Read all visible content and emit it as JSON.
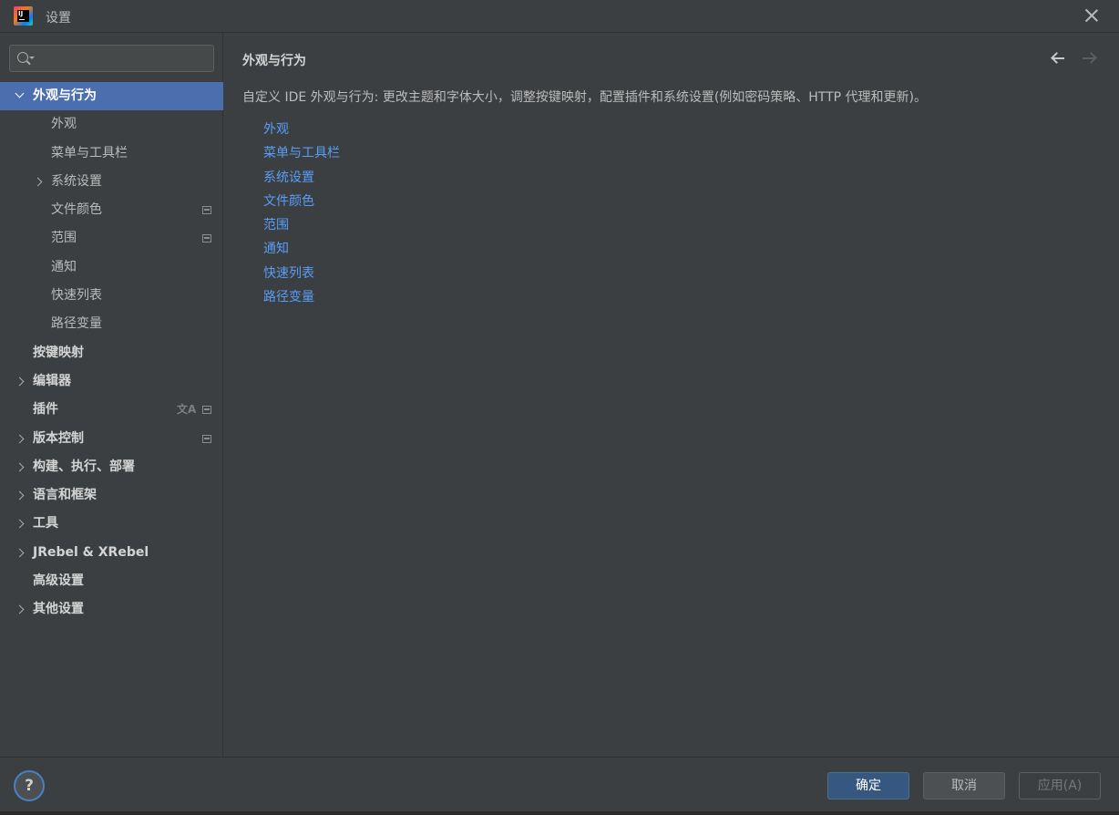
{
  "window": {
    "title": "设置",
    "logo_icon": "intellij-idea-logo",
    "logo_text": "IJ"
  },
  "sidebar": {
    "search": {
      "value": "",
      "placeholder": ""
    },
    "items": [
      {
        "label": "外观与行为",
        "level": 0,
        "arrow": "down",
        "selected": true
      },
      {
        "label": "外观",
        "level": 1
      },
      {
        "label": "菜单与工具栏",
        "level": 1
      },
      {
        "label": "系统设置",
        "level": 1,
        "arrow": "right"
      },
      {
        "label": "文件颜色",
        "level": 1,
        "badge": "project-icon"
      },
      {
        "label": "范围",
        "level": 1,
        "badge": "project-icon"
      },
      {
        "label": "通知",
        "level": 1
      },
      {
        "label": "快速列表",
        "level": 1
      },
      {
        "label": "路径变量",
        "level": 1
      },
      {
        "label": "按键映射",
        "level": 0
      },
      {
        "label": "编辑器",
        "level": 0,
        "arrow": "right"
      },
      {
        "label": "插件",
        "level": 0,
        "badge": "project-icon",
        "badge2": "translate-icon",
        "badge2_text": "文A"
      },
      {
        "label": "版本控制",
        "level": 0,
        "arrow": "right",
        "badge": "project-icon"
      },
      {
        "label": "构建、执行、部署",
        "level": 0,
        "arrow": "right"
      },
      {
        "label": "语言和框架",
        "level": 0,
        "arrow": "right"
      },
      {
        "label": "工具",
        "level": 0,
        "arrow": "right"
      },
      {
        "label": "JRebel & XRebel",
        "level": 0,
        "arrow": "right"
      },
      {
        "label": "高级设置",
        "level": 0
      },
      {
        "label": "其他设置",
        "level": 0,
        "arrow": "right"
      }
    ]
  },
  "content": {
    "title": "外观与行为",
    "description": "自定义 IDE 外观与行为: 更改主题和字体大小，调整按键映射，配置插件和系统设置(例如密码策略、HTTP 代理和更新)。",
    "links": [
      "外观",
      "菜单与工具栏",
      "系统设置",
      "文件颜色",
      "范围",
      "通知",
      "快速列表",
      "路径变量"
    ]
  },
  "footer": {
    "help_label": "?",
    "ok_label": "确定",
    "cancel_label": "取消",
    "apply_label": "应用(A)"
  },
  "colors": {
    "background": "#3c3f41",
    "selection": "#4b6eaf",
    "link": "#589df6",
    "primary_button": "#365880"
  }
}
